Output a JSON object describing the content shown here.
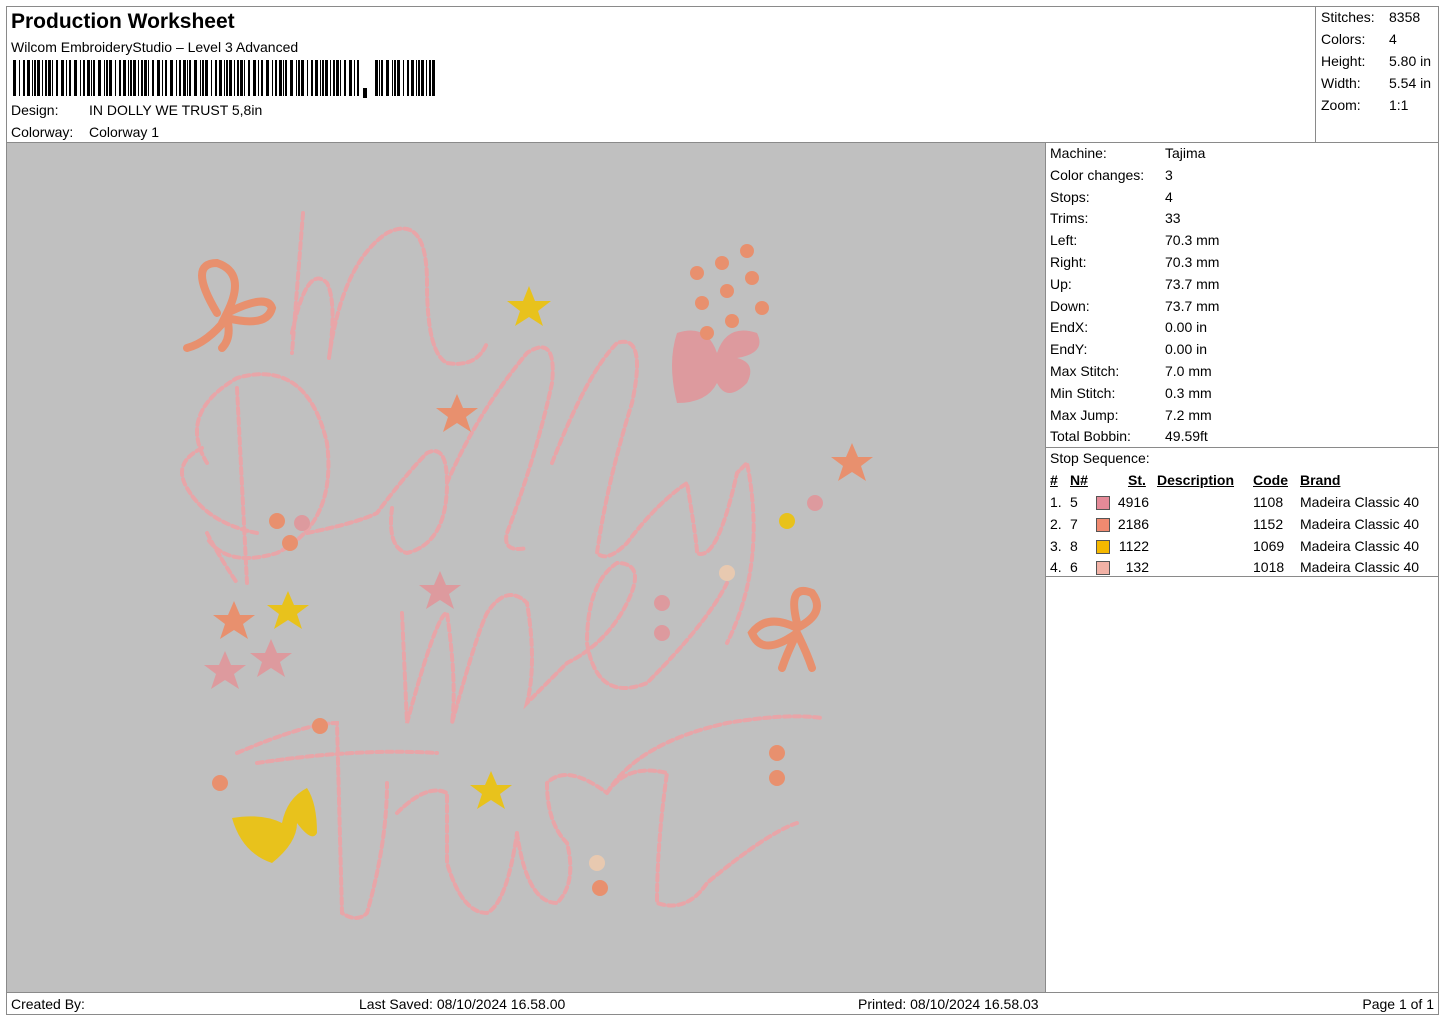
{
  "header": {
    "title": "Production Worksheet",
    "software": "Wilcom EmbroideryStudio – Level 3 Advanced",
    "design_label": "Design:",
    "design_value": "IN DOLLY WE TRUST 5,8in",
    "colorway_label": "Colorway:",
    "colorway_value": "Colorway 1"
  },
  "summary": {
    "stitches_label": "Stitches:",
    "stitches_value": "8358",
    "colors_label": "Colors:",
    "colors_value": "4",
    "height_label": "Height:",
    "height_value": "5.80 in",
    "width_label": "Width:",
    "width_value": "5.54 in",
    "zoom_label": "Zoom:",
    "zoom_value": "1:1"
  },
  "properties": [
    {
      "label": "Machine:",
      "value": "Tajima"
    },
    {
      "label": "Color changes:",
      "value": "3"
    },
    {
      "label": "Stops:",
      "value": "4"
    },
    {
      "label": "Trims:",
      "value": "33"
    },
    {
      "label": "Left:",
      "value": "70.3 mm"
    },
    {
      "label": "Right:",
      "value": "70.3 mm"
    },
    {
      "label": "Up:",
      "value": "73.7 mm"
    },
    {
      "label": "Down:",
      "value": "73.7 mm"
    },
    {
      "label": "EndX:",
      "value": "0.00 in"
    },
    {
      "label": "EndY:",
      "value": "0.00 in"
    },
    {
      "label": "Max Stitch:",
      "value": "7.0 mm"
    },
    {
      "label": "Min Stitch:",
      "value": "0.3 mm"
    },
    {
      "label": "Max Jump:",
      "value": "7.2 mm"
    },
    {
      "label": "Total Bobbin:",
      "value": "49.59ft"
    }
  ],
  "stop_sequence": {
    "title": "Stop Sequence:",
    "headers": {
      "num": "#",
      "n": "N#",
      "st": "St.",
      "description": "Description",
      "code": "Code",
      "brand": "Brand"
    },
    "rows": [
      {
        "num": "1.",
        "n": "5",
        "color": "#e58a98",
        "st": "4916",
        "description": "",
        "code": "1108",
        "brand": "Madeira Classic 40"
      },
      {
        "num": "2.",
        "n": "7",
        "color": "#f08a70",
        "st": "2186",
        "description": "",
        "code": "1152",
        "brand": "Madeira Classic 40"
      },
      {
        "num": "3.",
        "n": "8",
        "color": "#f5b800",
        "st": "1122",
        "description": "",
        "code": "1069",
        "brand": "Madeira Classic 40"
      },
      {
        "num": "4.",
        "n": "6",
        "color": "#f2b2a6",
        "st": "132",
        "description": "",
        "code": "1018",
        "brand": "Madeira Classic 40"
      }
    ]
  },
  "design": {
    "words": [
      "in",
      "Dolly",
      "we",
      "trust"
    ],
    "colors": {
      "pink": "#e8a5a8",
      "peach": "#e8906e",
      "gold": "#e8c21c",
      "rose": "#dd9a9e",
      "background": "#c0c0c0"
    }
  },
  "footer": {
    "created_by": "Created By:",
    "last_saved": "Last Saved: 08/10/2024 16.58.00",
    "printed": "Printed: 08/10/2024 16.58.03",
    "page": "Page 1 of 1"
  }
}
